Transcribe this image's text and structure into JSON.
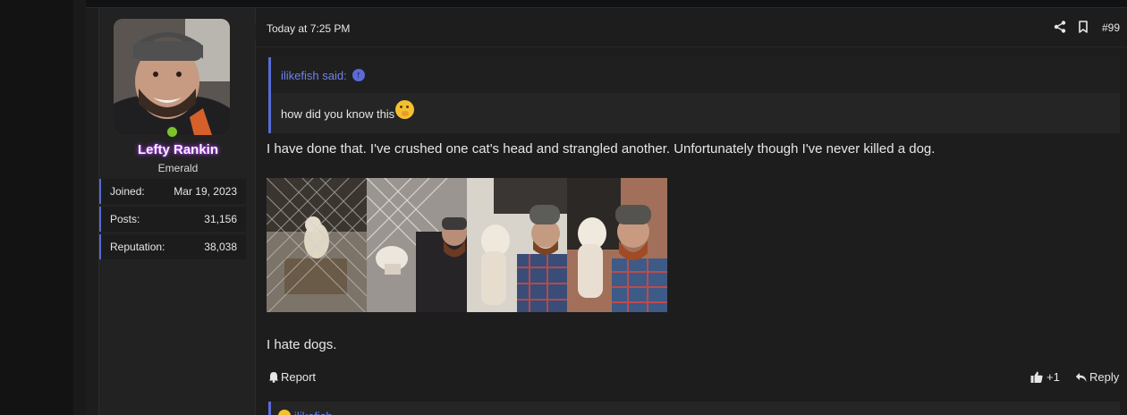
{
  "post": {
    "timestamp": "Today at 7:25 PM",
    "number": "#99"
  },
  "user": {
    "name": "Lefty Rankin",
    "title": "Emerald",
    "stats": [
      {
        "label": "Joined:",
        "value": "Mar 19, 2023"
      },
      {
        "label": "Posts:",
        "value": "31,156"
      },
      {
        "label": "Reputation:",
        "value": "38,038"
      }
    ]
  },
  "quote": {
    "author": "ilikefish said:",
    "text": "how did you know this",
    "emoji": "thinking-face-emoji"
  },
  "message": {
    "line1": "I have done that. I've crushed one cat's head and strangled another. Unfortunately though I've never killed a dog.",
    "line2": "I hate dogs."
  },
  "attachments": [
    {
      "icon": "photo-puppy-in-cage"
    },
    {
      "icon": "photo-man-with-puppy-at-fence"
    },
    {
      "icon": "photo-man-holding-puppy"
    },
    {
      "icon": "photo-man-holding-puppy-2"
    }
  ],
  "actions": {
    "report": "Report",
    "like_count": "+1",
    "reply": "Reply"
  },
  "next_quote": {
    "author": "ilikefish"
  },
  "colors": {
    "accent": "#5a6bd6",
    "quote_link": "#6f83e6",
    "online": "#7bc42a",
    "username_glow": "#b13cff"
  }
}
